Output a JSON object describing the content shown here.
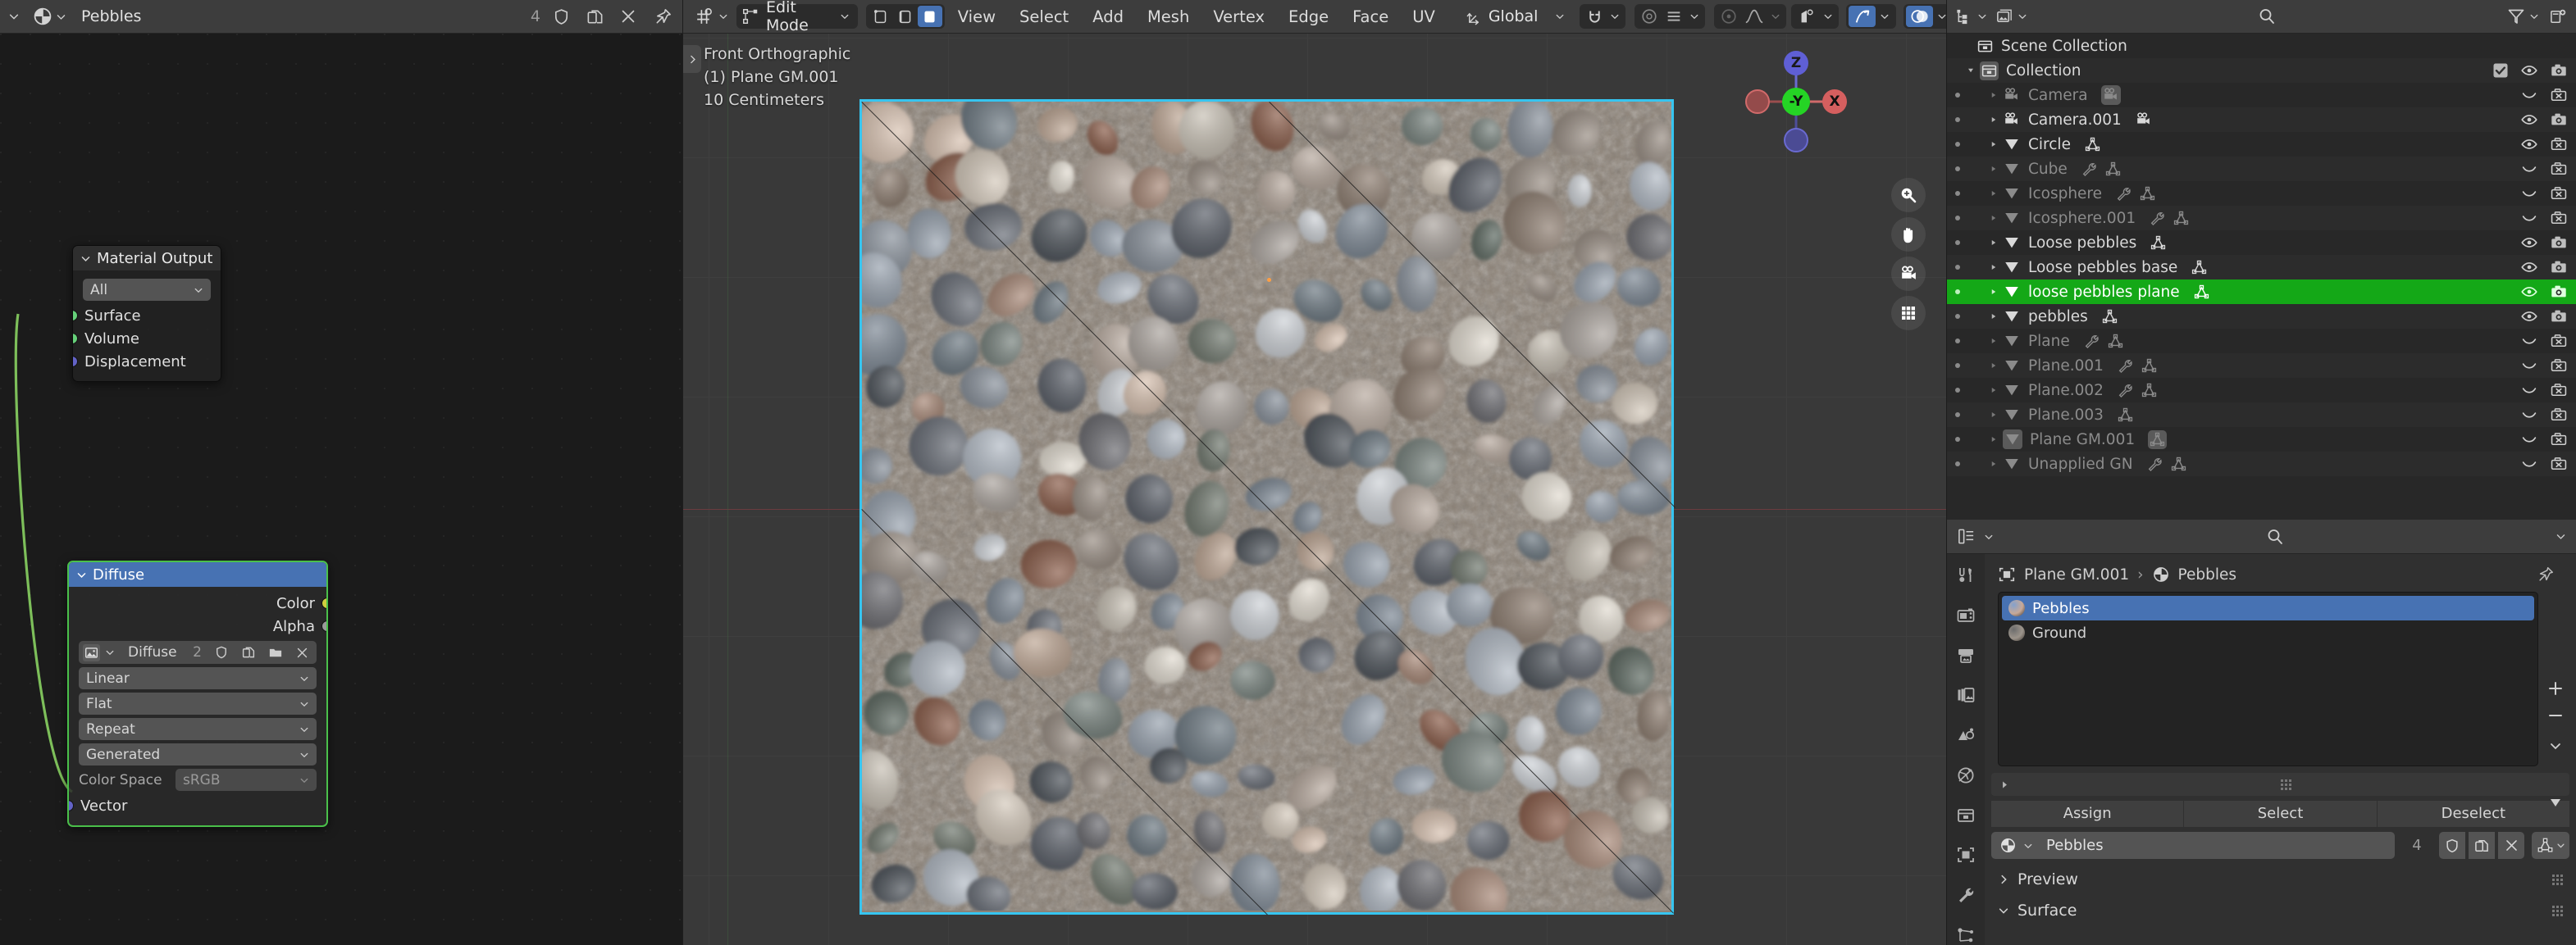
{
  "shader_editor": {
    "header": {
      "editor_type_icon": "shading-editor-icon",
      "browse_material_icon": "material-sphere-icon",
      "material_name": "Pebbles",
      "users_count": "4",
      "fake_user_icon": "shield-icon",
      "new_material_icon": "copy-icon",
      "unlink_icon": "x-icon",
      "pin_icon": "pin-icon"
    },
    "nodes": [
      {
        "name": "Material Output",
        "title": "Material Output",
        "target_value": "All",
        "inputs": [
          "Surface",
          "Volume",
          "Displacement"
        ],
        "socket_colors": [
          "#66d17a",
          "#66d17a",
          "#6363c7"
        ]
      },
      {
        "name": "Diffuse",
        "title": "Diffuse",
        "outputs": [
          "Color",
          "Alpha"
        ],
        "image_name": "Diffuse",
        "image_users": "2",
        "interpolation": "Linear",
        "projection": "Flat",
        "extension": "Repeat",
        "source": "Generated",
        "color_space_label": "Color Space",
        "color_space_value": "sRGB",
        "vector_input": "Vector"
      }
    ]
  },
  "viewport": {
    "header": {
      "editor_type_icon": "editor-type-icon",
      "mode": "Edit Mode",
      "select_mode_vertex_icon": "vertex-select-icon",
      "select_mode_edge_icon": "edge-select-icon",
      "select_mode_face_icon": "face-select-icon",
      "menus": [
        "View",
        "Select",
        "Add",
        "Mesh",
        "Vertex",
        "Edge",
        "Face",
        "UV"
      ],
      "transform_orientation": "Global",
      "snapping_icon": "magnet-icon",
      "proportional_edit_icon": "proportional-edit-icon",
      "falloff_icon": "smooth-falloff-icon",
      "mirror_icon": "mirror-icon",
      "xray_icon": "xray-icon",
      "shading_solid_icon": "shading-solid-icon",
      "shading_wire_icon": "shading-wireframe-icon",
      "shading_material_icon": "shading-material-icon",
      "shading_render_icon": "shading-rendered-icon",
      "overlays_icon": "overlays-icon",
      "gizmo_icon": "gizmo-icon",
      "visibility_icon": "visibility-icon"
    },
    "overlay_text": {
      "view_name": "Front Orthographic",
      "object_name": "(1) Plane GM.001",
      "grid_scale": "10 Centimeters"
    },
    "gizmo": {
      "axis_z": "Z",
      "axis_y": "-Y",
      "axis_x": "X",
      "zoom_icon": "zoom-icon",
      "pan_icon": "hand-icon",
      "camera_icon": "camera-icon",
      "ortho_icon": "grid-icon"
    }
  },
  "outliner": {
    "header": {
      "display_mode_icon": "outliner-display-mode-icon",
      "filter_id_icon": "id-type-icon",
      "search_icon": "search-icon",
      "filter_icon": "funnel-icon",
      "new_collection_icon": "new-collection-icon"
    },
    "root": {
      "label": "Scene Collection",
      "icon": "collection-icon"
    },
    "collection": {
      "label": "Collection",
      "icon": "collection-icon",
      "checkbox": true,
      "eye": true,
      "camera": true
    },
    "items": [
      {
        "label": "Camera",
        "icon": "camera-data-icon",
        "dimmed": true,
        "data_icons": [
          "camera-data-icon"
        ],
        "eye": false,
        "render": false
      },
      {
        "label": "Camera.001",
        "icon": "camera-data-icon",
        "dimmed": false,
        "data_icons": [
          "camera-data-icon"
        ],
        "eye": true,
        "render": true
      },
      {
        "label": "Circle",
        "icon": "mesh-icon",
        "dimmed": false,
        "data_icons": [
          "mesh-data-icon"
        ],
        "eye": true,
        "render": false
      },
      {
        "label": "Cube",
        "icon": "mesh-icon",
        "dimmed": true,
        "data_icons": [
          "modifier-icon",
          "mesh-data-icon"
        ],
        "eye": false,
        "render": false
      },
      {
        "label": "Icosphere",
        "icon": "mesh-icon",
        "dimmed": true,
        "data_icons": [
          "modifier-icon",
          "mesh-data-icon"
        ],
        "eye": false,
        "render": false
      },
      {
        "label": "Icosphere.001",
        "icon": "mesh-icon",
        "dimmed": true,
        "data_icons": [
          "modifier-icon",
          "mesh-data-icon"
        ],
        "eye": false,
        "render": false
      },
      {
        "label": "Loose pebbles",
        "icon": "mesh-icon",
        "dimmed": false,
        "data_icons": [
          "mesh-data-icon"
        ],
        "eye": true,
        "render": true
      },
      {
        "label": "Loose pebbles base",
        "icon": "mesh-icon",
        "dimmed": false,
        "data_icons": [
          "mesh-data-icon"
        ],
        "eye": true,
        "render": true
      },
      {
        "label": "loose pebbles plane",
        "icon": "mesh-icon",
        "dimmed": false,
        "active": true,
        "data_icons": [
          "mesh-data-icon"
        ],
        "eye": true,
        "render": true
      },
      {
        "label": "pebbles",
        "icon": "mesh-icon",
        "dimmed": false,
        "data_icons": [
          "mesh-data-icon"
        ],
        "eye": true,
        "render": true
      },
      {
        "label": "Plane",
        "icon": "mesh-icon",
        "dimmed": true,
        "data_icons": [
          "modifier-icon",
          "mesh-data-icon"
        ],
        "eye": false,
        "render": false
      },
      {
        "label": "Plane.001",
        "icon": "mesh-icon",
        "dimmed": true,
        "data_icons": [
          "modifier-icon",
          "mesh-data-icon"
        ],
        "eye": false,
        "render": false
      },
      {
        "label": "Plane.002",
        "icon": "mesh-icon",
        "dimmed": true,
        "data_icons": [
          "modifier-icon",
          "mesh-data-icon"
        ],
        "eye": false,
        "render": false
      },
      {
        "label": "Plane.003",
        "icon": "mesh-icon",
        "dimmed": true,
        "data_icons": [
          "mesh-data-icon"
        ],
        "eye": false,
        "render": false
      },
      {
        "label": "Plane GM.001",
        "icon": "mesh-icon",
        "dimmed": true,
        "selected_data": true,
        "data_icons": [
          "mesh-data-icon"
        ],
        "eye": false,
        "render": false
      },
      {
        "label": "Unapplied GN",
        "icon": "mesh-icon",
        "dimmed": true,
        "data_icons": [
          "modifier-icon",
          "mesh-data-icon"
        ],
        "eye": false,
        "render": false
      }
    ],
    "active_row_color": "#14a817"
  },
  "properties": {
    "header": {
      "editor_icon": "properties-editor-icon",
      "search_icon": "search-icon",
      "chevron_icon": "chevron-down-icon"
    },
    "tabs": [
      {
        "name": "tool",
        "icon": "tool-icon",
        "active": false
      },
      {
        "name": "render",
        "icon": "render-icon",
        "active": false
      },
      {
        "name": "output",
        "icon": "printer-icon",
        "active": false
      },
      {
        "name": "view-layer",
        "icon": "images-icon",
        "active": false
      },
      {
        "name": "scene",
        "icon": "scene-icon",
        "active": false
      },
      {
        "name": "world",
        "icon": "world-icon",
        "active": false
      },
      {
        "name": "collection",
        "icon": "collection-icon",
        "active": false
      },
      {
        "name": "object",
        "icon": "object-icon",
        "active": false
      },
      {
        "name": "modifiers",
        "icon": "wrench-icon",
        "active": false
      },
      {
        "name": "particles",
        "icon": "particles-icon",
        "active": false
      }
    ],
    "breadcrumb": {
      "object_icon": "object-icon",
      "object": "Plane GM.001",
      "separator": "›",
      "material_icon": "material-sphere-icon",
      "material": "Pebbles",
      "pin_icon": "pin-icon"
    },
    "material_slots": [
      {
        "label": "Pebbles",
        "active": true,
        "thumb": "#c7a998"
      },
      {
        "label": "Ground",
        "active": false,
        "thumb": "#9c948b"
      }
    ],
    "slot_buttons": {
      "add_icon": "plus-icon",
      "remove_icon": "minus-icon",
      "menu_icon": "chevron-down-icon",
      "move_up_icon": "triangle-up-icon",
      "move_down_icon": "triangle-down-icon"
    },
    "specials_row_icon": "expand-arrow-icon",
    "actions": [
      "Assign",
      "Select",
      "Deselect"
    ],
    "material_field": {
      "browse_icon": "material-sphere-icon",
      "name": "Pebbles",
      "users": "4",
      "fake_user_icon": "shield-icon",
      "new_icon": "copy-icon",
      "unlink_icon": "x-icon",
      "data_icon": "mesh-data-icon"
    },
    "panels": [
      {
        "label": "Preview",
        "expanded": false
      },
      {
        "label": "Surface",
        "expanded": true
      }
    ]
  }
}
